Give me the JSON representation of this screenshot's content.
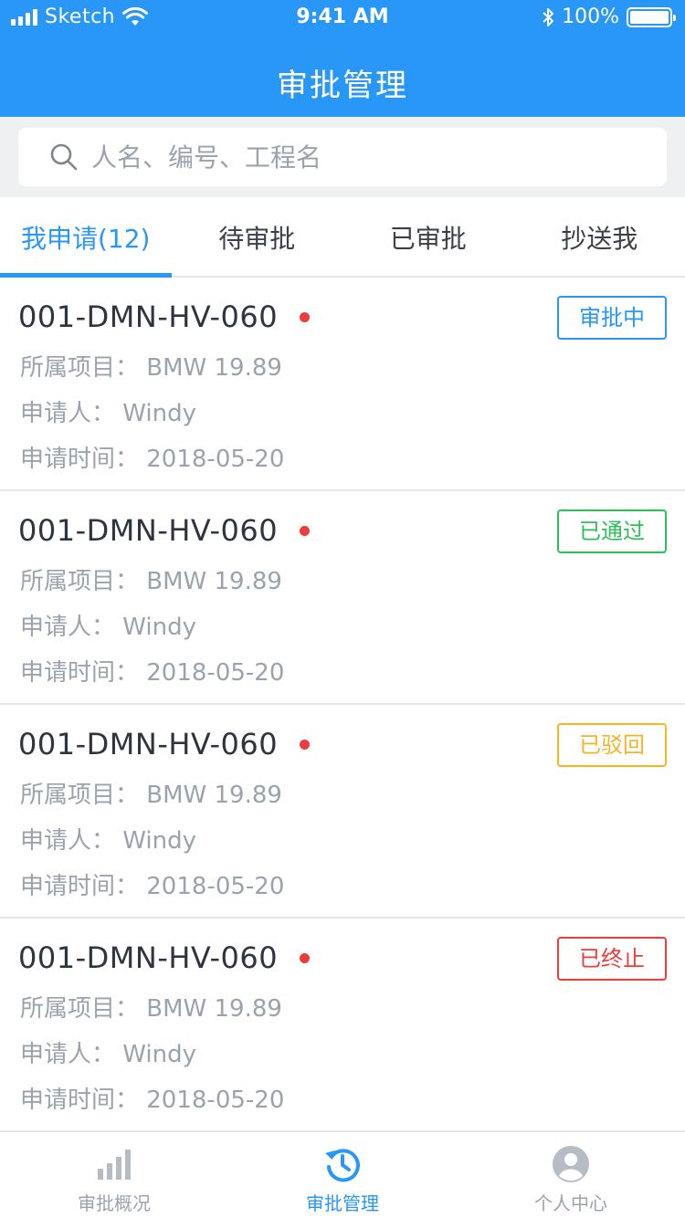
{
  "statusbar": {
    "carrier": "Sketch",
    "time": "9:41 AM",
    "battery": "100%"
  },
  "header": {
    "title": "审批管理"
  },
  "search": {
    "placeholder": "人名、编号、工程名"
  },
  "tabs": [
    {
      "label": "我申请(12)",
      "active": true
    },
    {
      "label": "待审批",
      "active": false
    },
    {
      "label": "已审批",
      "active": false
    },
    {
      "label": "抄送我",
      "active": false
    }
  ],
  "items": [
    {
      "code": "001-DMN-HV-060",
      "project": "所属项目： BMW 19.89",
      "applicant": "申请人： Windy",
      "time": "申请时间： 2018-05-20",
      "status": "审批中",
      "status_color": "#2997f7"
    },
    {
      "code": "001-DMN-HV-060",
      "project": "所属项目： BMW 19.89",
      "applicant": "申请人： Windy",
      "time": "申请时间： 2018-05-20",
      "status": "已通过",
      "status_color": "#2cbf5a"
    },
    {
      "code": "001-DMN-HV-060",
      "project": "所属项目： BMW 19.89",
      "applicant": "申请人： Windy",
      "time": "申请时间： 2018-05-20",
      "status": "已驳回",
      "status_color": "#f5b325"
    },
    {
      "code": "001-DMN-HV-060",
      "project": "所属项目： BMW 19.89",
      "applicant": "申请人： Windy",
      "time": "申请时间： 2018-05-20",
      "status": "已终止",
      "status_color": "#ef3b3b"
    }
  ],
  "tabbar": [
    {
      "label": "审批概况",
      "icon": "bar-chart-icon",
      "active": false
    },
    {
      "label": "审批管理",
      "icon": "history-icon",
      "active": true
    },
    {
      "label": "个人中心",
      "icon": "user-icon",
      "active": false
    }
  ],
  "colors": {
    "primary": "#2997f7",
    "unread_dot": "#ef3b3b"
  }
}
